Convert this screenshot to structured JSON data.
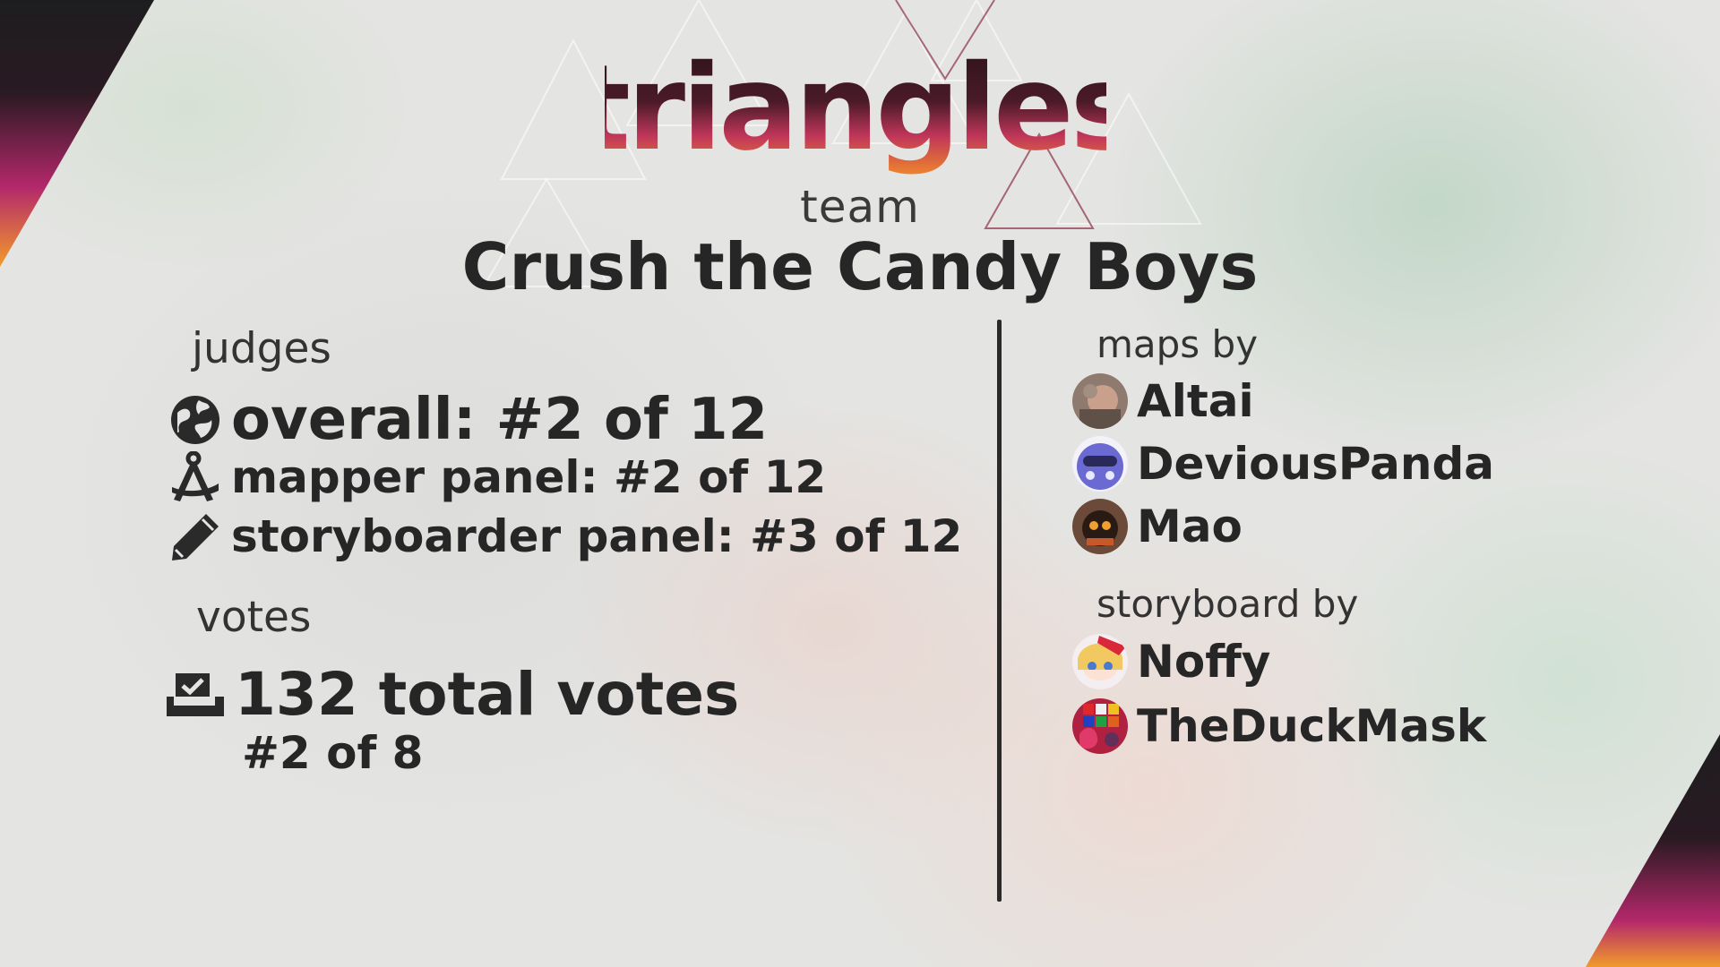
{
  "logo": {
    "text": "triangles",
    "colors": [
      "#2a1418",
      "#8a1f3a",
      "#d23c5a",
      "#f08a2a"
    ]
  },
  "team": {
    "label": "team",
    "name": "Crush the Candy Boys"
  },
  "judges": {
    "title": "judges",
    "overall": {
      "icon": "globe-icon",
      "text": "overall: #2 of 12"
    },
    "mapper": {
      "icon": "compass-icon",
      "text": "mapper panel: #2 of 12"
    },
    "storyboarder": {
      "icon": "pencil-icon",
      "text": "storyboarder panel: #3 of 12"
    }
  },
  "votes": {
    "title": "votes",
    "icon": "ballot-check-icon",
    "total": "132 total votes",
    "rank": "#2 of 8"
  },
  "maps": {
    "title": "maps by",
    "people": [
      {
        "name": "Altai",
        "avatar": "avatar-altai"
      },
      {
        "name": "DeviousPanda",
        "avatar": "avatar-deviouspanda"
      },
      {
        "name": "Mao",
        "avatar": "avatar-mao"
      }
    ]
  },
  "storyboard": {
    "title": "storyboard by",
    "people": [
      {
        "name": "Noffy",
        "avatar": "avatar-noffy"
      },
      {
        "name": "TheDuckMask",
        "avatar": "avatar-theduckmask"
      }
    ]
  },
  "accent_colors": {
    "magenta": "#b0286a",
    "orange": "#f09a2a",
    "dark": "#1f1f1f"
  }
}
